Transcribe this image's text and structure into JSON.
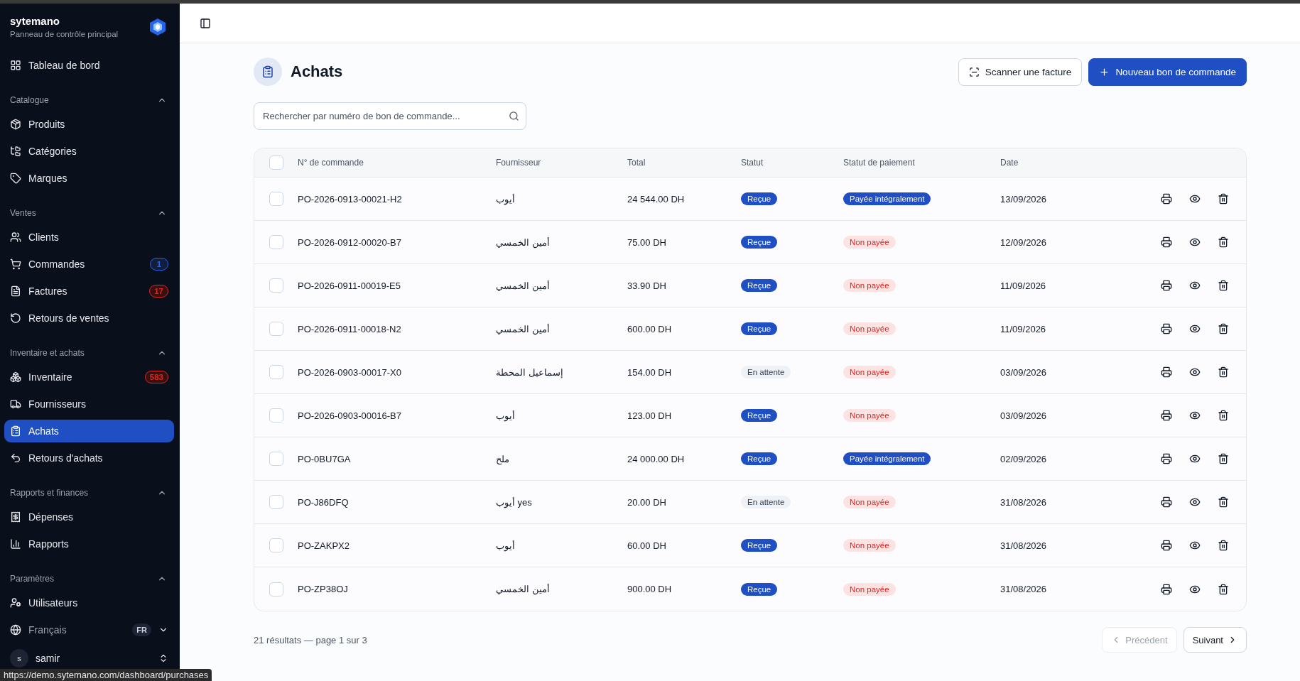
{
  "sidebar": {
    "brand": "sytemano",
    "subtitle": "Panneau de contrôle principal",
    "top_item": {
      "label": "Tableau de bord",
      "selected": false
    },
    "groups": [
      {
        "title": "Catalogue",
        "expanded": true,
        "items": [
          {
            "label": "Produits",
            "selected": false
          },
          {
            "label": "Catégories",
            "selected": false
          },
          {
            "label": "Marques",
            "selected": false
          }
        ]
      },
      {
        "title": "Ventes",
        "expanded": true,
        "items": [
          {
            "label": "Clients",
            "selected": false
          },
          {
            "label": "Commandes",
            "selected": false,
            "badge": "1",
            "color": "#2563eb"
          },
          {
            "label": "Factures",
            "selected": false,
            "badge": "17",
            "color": "#dc2626"
          },
          {
            "label": "Retours de ventes",
            "selected": false
          }
        ]
      },
      {
        "title": "Inventaire et achats",
        "expanded": true,
        "items": [
          {
            "label": "Inventaire",
            "selected": false,
            "badge": "583",
            "color": "#dc2626"
          },
          {
            "label": "Fournisseurs",
            "selected": false
          },
          {
            "label": "Achats",
            "selected": true
          },
          {
            "label": "Retours d'achats",
            "selected": false
          }
        ]
      },
      {
        "title": "Rapports et finances",
        "expanded": true,
        "items": [
          {
            "label": "Dépenses",
            "selected": false
          },
          {
            "label": "Rapports",
            "selected": false
          }
        ]
      },
      {
        "title": "Paramètres",
        "expanded": true,
        "items": [
          {
            "label": "Utilisateurs",
            "selected": false
          }
        ]
      }
    ],
    "language": {
      "label": "Français",
      "code": "FR"
    },
    "user": {
      "initial": "s",
      "name": "samir"
    }
  },
  "page": {
    "title": "Achats",
    "buttons": [
      {
        "label": "Scanner une facture",
        "kind": "secondary"
      },
      {
        "label": "Nouveau bon de commande",
        "kind": "primary"
      }
    ],
    "search": {
      "placeholder": "Rechercher par numéro de bon de commande..."
    }
  },
  "table": {
    "all_checked": false,
    "columns": [
      "N° de commande",
      "Fournisseur",
      "Total",
      "Statut",
      "Statut de paiement",
      "Date"
    ],
    "rows": [
      {
        "checked": false,
        "order": "PO-2026-0913-00021-H2",
        "supplier": "أيوب",
        "total": "24 544.00 DH",
        "status": {
          "label": "Reçue",
          "kind": "received"
        },
        "payment": {
          "label": "Payée intégralement",
          "kind": "paid"
        },
        "date": "13/09/2026"
      },
      {
        "checked": false,
        "order": "PO-2026-0912-00020-B7",
        "supplier": "أمين الخمسي",
        "total": "75.00 DH",
        "status": {
          "label": "Reçue",
          "kind": "received"
        },
        "payment": {
          "label": "Non payée",
          "kind": "unpaid"
        },
        "date": "12/09/2026"
      },
      {
        "checked": false,
        "order": "PO-2026-0911-00019-E5",
        "supplier": "أمين الخمسي",
        "total": "33.90 DH",
        "status": {
          "label": "Reçue",
          "kind": "received"
        },
        "payment": {
          "label": "Non payée",
          "kind": "unpaid"
        },
        "date": "11/09/2026"
      },
      {
        "checked": false,
        "order": "PO-2026-0911-00018-N2",
        "supplier": "أمين الخمسي",
        "total": "600.00 DH",
        "status": {
          "label": "Reçue",
          "kind": "received"
        },
        "payment": {
          "label": "Non payée",
          "kind": "unpaid"
        },
        "date": "11/09/2026"
      },
      {
        "checked": false,
        "order": "PO-2026-0903-00017-X0",
        "supplier": "إسماعيل المحطة",
        "total": "154.00 DH",
        "status": {
          "label": "En attente",
          "kind": "pending"
        },
        "payment": {
          "label": "Non payée",
          "kind": "unpaid"
        },
        "date": "03/09/2026"
      },
      {
        "checked": false,
        "order": "PO-2026-0903-00016-B7",
        "supplier": "أيوب",
        "total": "123.00 DH",
        "status": {
          "label": "Reçue",
          "kind": "received"
        },
        "payment": {
          "label": "Non payée",
          "kind": "unpaid"
        },
        "date": "03/09/2026"
      },
      {
        "checked": false,
        "order": "PO-0BU7GA",
        "supplier": "ملح",
        "total": "24 000.00 DH",
        "status": {
          "label": "Reçue",
          "kind": "received"
        },
        "payment": {
          "label": "Payée intégralement",
          "kind": "paid"
        },
        "date": "02/09/2026"
      },
      {
        "checked": false,
        "order": "PO-J86DFQ",
        "supplier": "أيوب yes",
        "total": "20.00 DH",
        "status": {
          "label": "En attente",
          "kind": "pending"
        },
        "payment": {
          "label": "Non payée",
          "kind": "unpaid"
        },
        "date": "31/08/2026"
      },
      {
        "checked": false,
        "order": "PO-ZAKPX2",
        "supplier": "أيوب",
        "total": "60.00 DH",
        "status": {
          "label": "Reçue",
          "kind": "received"
        },
        "payment": {
          "label": "Non payée",
          "kind": "unpaid"
        },
        "date": "31/08/2026"
      },
      {
        "checked": false,
        "order": "PO-ZP38OJ",
        "supplier": "أمين الخمسي",
        "total": "900.00 DH",
        "status": {
          "label": "Reçue",
          "kind": "received"
        },
        "payment": {
          "label": "Non payée",
          "kind": "unpaid"
        },
        "date": "31/08/2026"
      }
    ]
  },
  "pagination": {
    "summary": "21 résultats — page 1 sur 3",
    "prev": {
      "label": "Précédent",
      "disabled": true
    },
    "next": {
      "label": "Suivant",
      "disabled": false
    }
  },
  "status_url": "https://demo.sytemano.com/dashboard/purchases"
}
